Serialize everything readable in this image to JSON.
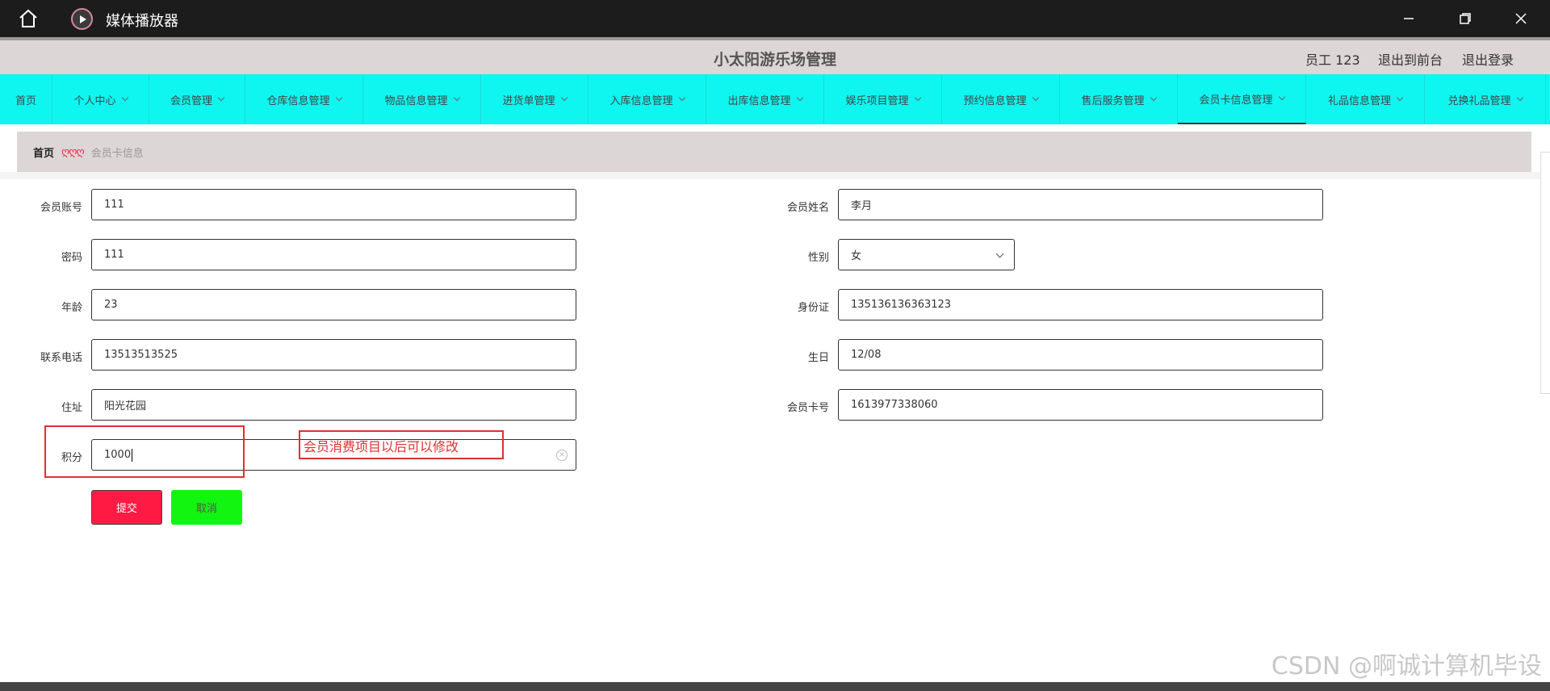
{
  "titlebar": {
    "title": "媒体播放器"
  },
  "header": {
    "title": "小太阳游乐场管理",
    "user": "员工 123",
    "front": "退出到前台",
    "logout": "退出登录"
  },
  "nav": [
    {
      "label": "首页",
      "dropdown": false
    },
    {
      "label": "个人中心",
      "dropdown": true
    },
    {
      "label": "会员管理",
      "dropdown": true
    },
    {
      "label": "仓库信息管理",
      "dropdown": true
    },
    {
      "label": "物品信息管理",
      "dropdown": true
    },
    {
      "label": "进货单管理",
      "dropdown": true
    },
    {
      "label": "入库信息管理",
      "dropdown": true
    },
    {
      "label": "出库信息管理",
      "dropdown": true
    },
    {
      "label": "娱乐项目管理",
      "dropdown": true
    },
    {
      "label": "预约信息管理",
      "dropdown": true
    },
    {
      "label": "售后服务管理",
      "dropdown": true
    },
    {
      "label": "会员卡信息管理",
      "dropdown": true,
      "active": true
    },
    {
      "label": "礼品信息管理",
      "dropdown": true
    },
    {
      "label": "兑换礼品管理",
      "dropdown": true
    }
  ],
  "breadcrumb": {
    "home": "首页",
    "separator": "ღღღ",
    "current": "会员卡信息"
  },
  "form": {
    "account": {
      "label": "会员账号",
      "value": "111"
    },
    "name": {
      "label": "会员姓名",
      "value": "李月"
    },
    "password": {
      "label": "密码",
      "value": "111"
    },
    "gender": {
      "label": "性别",
      "value": "女"
    },
    "age": {
      "label": "年龄",
      "value": "23"
    },
    "idcard": {
      "label": "身份证",
      "value": "135136136363123"
    },
    "phone": {
      "label": "联系电话",
      "value": "13513513525"
    },
    "birthday": {
      "label": "生日",
      "value": "12/08"
    },
    "address": {
      "label": "住址",
      "value": "阳光花园"
    },
    "cardno": {
      "label": "会员卡号",
      "value": "1613977338060"
    },
    "points": {
      "label": "积分",
      "value": "1000"
    }
  },
  "buttons": {
    "submit": "提交",
    "cancel": "取消"
  },
  "annotation": {
    "text": "会员消费项目以后可以修改"
  },
  "watermark": "CSDN @啊诚计算机毕设",
  "colors": {
    "nav_bg": "#0ff6f0",
    "submit": "#ff1a44",
    "cancel": "#11f511",
    "annotation": "#e03030"
  }
}
